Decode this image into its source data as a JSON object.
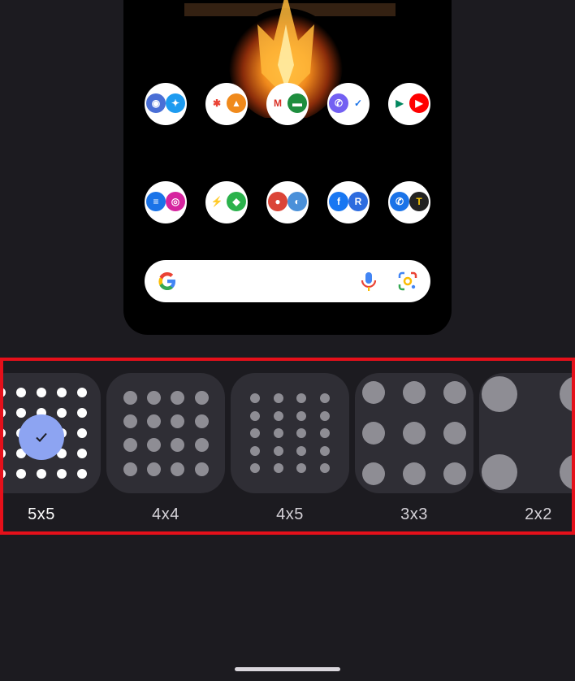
{
  "preview": {
    "apps_row1": [
      {
        "a": "camera-icon",
        "b": "twitter-icon"
      },
      {
        "a": "photos-icon",
        "b": "gallery-icon"
      },
      {
        "a": "gmail-icon",
        "b": "drive-icon"
      },
      {
        "a": "viber-icon",
        "b": "tasks-icon"
      },
      {
        "a": "play-store-icon",
        "b": "youtube-icon"
      }
    ],
    "apps_row2": [
      {
        "a": "messages-icon",
        "b": "instagram-icon"
      },
      {
        "a": "messenger-icon",
        "b": "feedly-icon"
      },
      {
        "a": "chrome-icon",
        "b": "browser-icon"
      },
      {
        "a": "facebook-icon",
        "b": "reader-icon"
      },
      {
        "a": "phone-icon",
        "b": "tile-icon"
      }
    ]
  },
  "grid_options": [
    {
      "label": "5x5",
      "rows": 5,
      "cols": 5,
      "selected": true
    },
    {
      "label": "4x4",
      "rows": 4,
      "cols": 4,
      "selected": false
    },
    {
      "label": "4x5",
      "rows": 5,
      "cols": 4,
      "selected": false
    },
    {
      "label": "3x3",
      "rows": 3,
      "cols": 3,
      "selected": false
    },
    {
      "label": "2x2",
      "rows": 2,
      "cols": 2,
      "selected": false
    }
  ],
  "colors": {
    "accent": "#8da4f2",
    "highlight": "#e5101a"
  }
}
